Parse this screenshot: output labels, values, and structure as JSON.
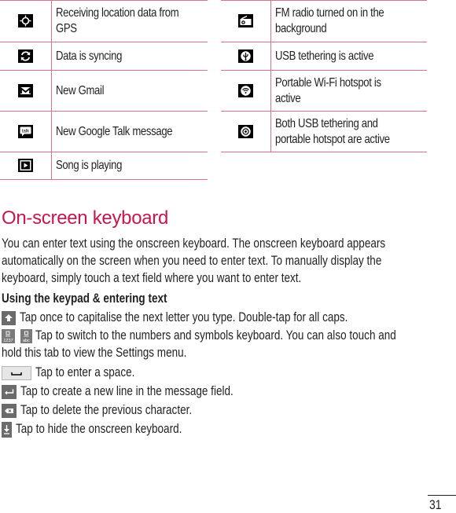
{
  "status_icons_left": [
    {
      "icon": "gps-location-icon",
      "text": "Receiving location data from GPS",
      "lines": [
        "Receiving location data from",
        "GPS"
      ]
    },
    {
      "icon": "sync-icon",
      "text": "Data is syncing",
      "lines": [
        "Data is syncing"
      ]
    },
    {
      "icon": "gmail-icon",
      "text": "New Gmail",
      "lines": [
        "New Gmail"
      ]
    },
    {
      "icon": "google-talk-icon",
      "text": "New Google Talk message",
      "lines": [
        "New Google Talk message"
      ],
      "icon_label": "talk"
    },
    {
      "icon": "play-icon",
      "text": "Song is playing",
      "lines": [
        "Song is playing"
      ]
    }
  ],
  "status_icons_right": [
    {
      "icon": "fm-radio-icon",
      "text": "FM radio turned on in the background",
      "lines": [
        "FM radio turned on in the",
        "background"
      ]
    },
    {
      "icon": "usb-tethering-icon",
      "text": "USB tethering is active",
      "lines": [
        "USB tethering is active"
      ]
    },
    {
      "icon": "wifi-hotspot-icon",
      "text": "Portable Wi-Fi hotspot is active",
      "lines": [
        "Portable Wi-Fi hotspot is",
        "active"
      ]
    },
    {
      "icon": "usb-and-hotspot-icon",
      "text": "Both USB tethering and portable hotspot are active",
      "lines": [
        "Both USB tethering and",
        "portable hotspot are active"
      ]
    }
  ],
  "section": {
    "heading": "On-screen keyboard",
    "intro_lines": [
      "You can enter text using the onscreen keyboard. The onscreen keyboard appears",
      "automatically on the screen when you need to enter text. To manually display the",
      "keyboard, simply touch a text field where you want to enter text."
    ],
    "subheading": "Using the keypad & entering text",
    "keys": [
      {
        "icon": "shift-key-icon",
        "lines": [
          "Tap once to capitalise the next letter you type. Double-tap for all caps."
        ]
      },
      {
        "icon": "symbols-key-icon",
        "icon_labels": [
          "1237",
          "abc"
        ],
        "lines": [
          "Tap to switch to the numbers and symbols keyboard. You can also touch and",
          "hold this tab to view the Settings menu."
        ]
      },
      {
        "icon": "space-key-icon",
        "lines": [
          "Tap to enter a space."
        ]
      },
      {
        "icon": "enter-key-icon",
        "lines": [
          "Tap to create a new line in the message field."
        ]
      },
      {
        "icon": "backspace-key-icon",
        "lines": [
          "Tap to delete the previous character."
        ]
      },
      {
        "icon": "hide-keyboard-key-icon",
        "lines": [
          "Tap to hide the onscreen keyboard."
        ]
      }
    ]
  },
  "colors": {
    "accent": "#c8174f",
    "table_rule": "#d8708e",
    "text": "#231f20"
  },
  "page_number": "31"
}
